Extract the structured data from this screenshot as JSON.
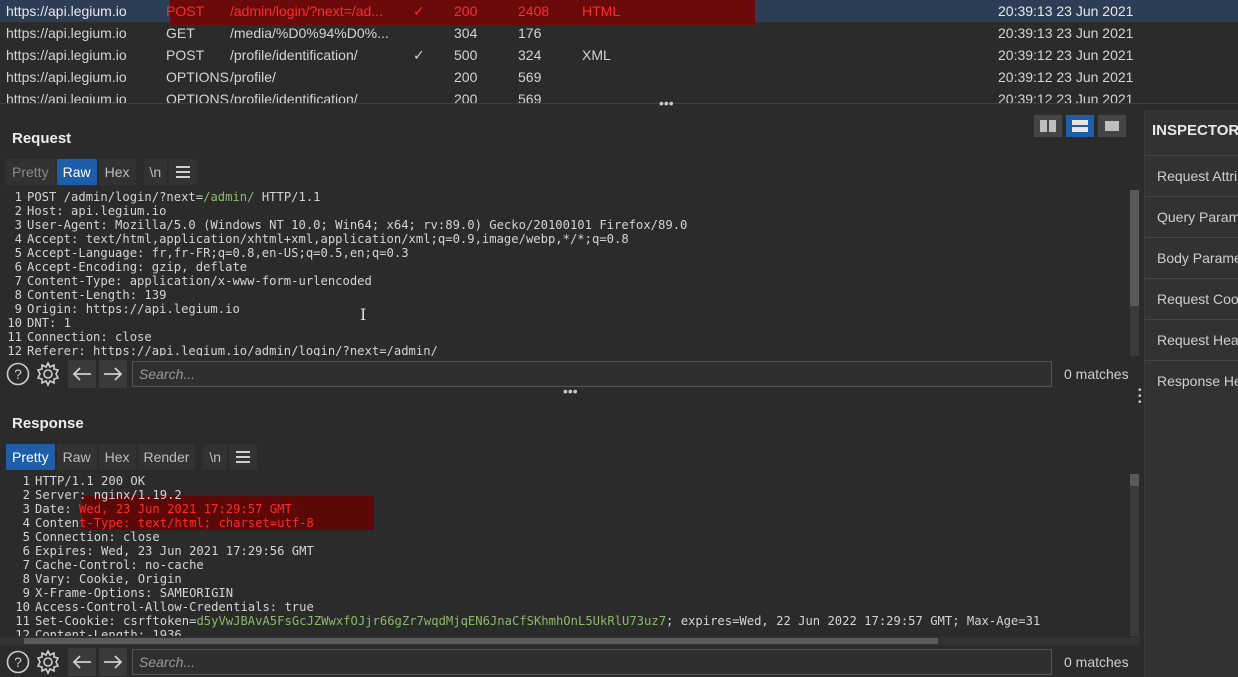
{
  "history": {
    "rows": [
      {
        "host": "https://api.legium.io",
        "method": "POST",
        "url": "/admin/login/?next=/ad...",
        "edited": "✓",
        "status": "200",
        "length": "2408",
        "mime": "HTML",
        "time": "20:39:13 23 Jun 2021",
        "selected": true,
        "highlight": "red"
      },
      {
        "host": "https://api.legium.io",
        "method": "GET",
        "url": "/media/%D0%94%D0%...",
        "edited": "",
        "status": "304",
        "length": "176",
        "mime": "",
        "time": "20:39:13 23 Jun 2021"
      },
      {
        "host": "https://api.legium.io",
        "method": "POST",
        "url": "/profile/identification/",
        "edited": "✓",
        "status": "500",
        "length": "324",
        "mime": "XML",
        "time": "20:39:12 23 Jun 2021"
      },
      {
        "host": "https://api.legium.io",
        "method": "OPTIONS",
        "url": "/profile/",
        "edited": "",
        "status": "200",
        "length": "569",
        "mime": "",
        "time": "20:39:12 23 Jun 2021"
      },
      {
        "host": "https://api.legium.io",
        "method": "OPTIONS",
        "url": "/profile/identification/",
        "edited": "",
        "status": "200",
        "length": "569",
        "mime": "",
        "time": "20:39:12 23 Jun 2021"
      }
    ]
  },
  "request": {
    "title": "Request",
    "tabs": [
      "Pretty",
      "Raw",
      "Hex",
      "\\n"
    ],
    "active_tab": "Raw",
    "lines": [
      {
        "n": "1",
        "parts": [
          {
            "t": "POST /admin/login/?next="
          },
          {
            "t": "/admin/",
            "c": "green"
          },
          {
            "t": " HTTP/1.1"
          }
        ]
      },
      {
        "n": "2",
        "parts": [
          {
            "t": "Host: api.legium.io"
          }
        ]
      },
      {
        "n": "3",
        "parts": [
          {
            "t": "User-Agent: Mozilla/5.0 (Windows NT 10.0; Win64; x64; rv:89.0) Gecko/20100101 Firefox/89.0"
          }
        ]
      },
      {
        "n": "4",
        "parts": [
          {
            "t": "Accept: text/html,application/xhtml+xml,application/xml;q=0.9,image/webp,*/*;q=0.8"
          }
        ]
      },
      {
        "n": "5",
        "parts": [
          {
            "t": "Accept-Language: fr,fr-FR;q=0.8,en-US;q=0.5,en;q=0.3"
          }
        ]
      },
      {
        "n": "6",
        "parts": [
          {
            "t": "Accept-Encoding: gzip, deflate"
          }
        ]
      },
      {
        "n": "7",
        "parts": [
          {
            "t": "Content-Type: application/x-www-form-urlencoded"
          }
        ]
      },
      {
        "n": "8",
        "parts": [
          {
            "t": "Content-Length: 139"
          }
        ]
      },
      {
        "n": "9",
        "parts": [
          {
            "t": "Origin: https://api.legium.io"
          }
        ]
      },
      {
        "n": "10",
        "parts": [
          {
            "t": "DNT: 1"
          }
        ]
      },
      {
        "n": "11",
        "parts": [
          {
            "t": "Connection: close"
          }
        ]
      },
      {
        "n": "12",
        "parts": [
          {
            "t": "Referer: https://api.legium.io/admin/login/?next=/admin/"
          }
        ]
      }
    ],
    "search_placeholder": "Search...",
    "matches": "0 matches"
  },
  "response": {
    "title": "Response",
    "tabs": [
      "Pretty",
      "Raw",
      "Hex",
      "Render",
      "\\n"
    ],
    "active_tab": "Pretty",
    "lines": [
      {
        "n": "1",
        "parts": [
          {
            "t": "HTTP/1.1 200 OK"
          }
        ]
      },
      {
        "n": "2",
        "parts": [
          {
            "t": "Server: nginx/1.19.2"
          }
        ]
      },
      {
        "n": "3",
        "parts": [
          {
            "t": "Date: "
          },
          {
            "t": "Wed, 23 Jun 2021 17:29:57 GMT",
            "c": "redtxt"
          }
        ]
      },
      {
        "n": "4",
        "parts": [
          {
            "t": "Conten"
          },
          {
            "t": "t-Type: text/html; charset=utf-8",
            "c": "redtxt"
          }
        ]
      },
      {
        "n": "5",
        "parts": [
          {
            "t": "Connection: close"
          }
        ]
      },
      {
        "n": "6",
        "parts": [
          {
            "t": "Expires: Wed, 23 Jun 2021 17:29:56 GMT"
          }
        ]
      },
      {
        "n": "7",
        "parts": [
          {
            "t": "Cache-Control: no-cache"
          }
        ]
      },
      {
        "n": "8",
        "parts": [
          {
            "t": "Vary: Cookie, Origin"
          }
        ]
      },
      {
        "n": "9",
        "parts": [
          {
            "t": "X-Frame-Options: SAMEORIGIN"
          }
        ]
      },
      {
        "n": "10",
        "parts": [
          {
            "t": "Access-Control-Allow-Credentials: true"
          }
        ]
      },
      {
        "n": "11",
        "parts": [
          {
            "t": "Set-Cookie: csrftoken="
          },
          {
            "t": "d5yVwJBAvA5FsGcJZWwxfOJjr66gZr7wqdMjqEN6JnaCfSKhmhOnL5UkRlU73uz7",
            "c": "green"
          },
          {
            "t": "; expires=Wed, 22 Jun 2022 17:29:57 GMT; Max-Age=31"
          }
        ]
      },
      {
        "n": "12",
        "parts": [
          {
            "t": "Content-Length: 1936"
          }
        ]
      }
    ],
    "search_placeholder": "Search...",
    "matches": "0 matches"
  },
  "inspector": {
    "title": "INSPECTOR",
    "sections": [
      "Request Attri",
      "Query Parame",
      "Body Parame",
      "Request Cook",
      "Request Head",
      "Response Hea"
    ]
  },
  "icons": [
    "help-icon",
    "settings-icon",
    "back-arrow-icon",
    "forward-arrow-icon",
    "menu-icon",
    "split-horizontal-icon",
    "split-vertical-icon",
    "single-pane-icon"
  ],
  "colors": {
    "accent": "#1e5ea8",
    "highlight_red": "#ff2a2a",
    "highlight_bg": "#6b0a0a",
    "value_green": "#8db86b"
  }
}
